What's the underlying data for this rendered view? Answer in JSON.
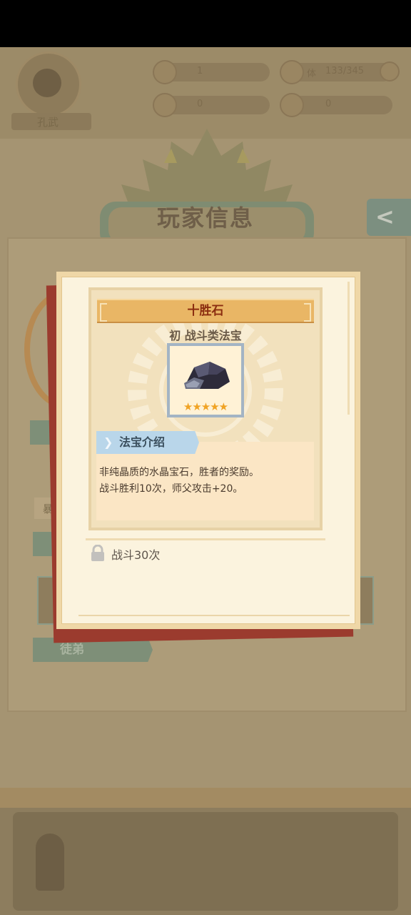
{
  "background": {
    "player_name": "孔武",
    "stat_top_left": "1",
    "stat_top_right_label": "体",
    "stat_top_right_value": "133/345",
    "stat_mid_left": "0",
    "stat_mid_right": "0",
    "title": "玩家信息",
    "side_label": "暴",
    "tab_bottom": "徒弟"
  },
  "modal": {
    "item_name": "十胜石",
    "item_type": "初 战斗类法宝",
    "stars": "★★★★★",
    "intro_title": "法宝介绍",
    "description_lines": [
      "非纯晶质的水晶宝石，胜者的奖励。",
      "战斗胜利10次，师父攻击+20。"
    ],
    "unlock_condition": "战斗30次"
  },
  "colors": {
    "overlay_bg": "#a59472",
    "modal_bg": "#fbf3de",
    "title_bar": "#e9b665",
    "item_name": "#8b2d10",
    "intro_tab": "#b9d6ea",
    "star": "#f0a324"
  },
  "icons": [
    "back-arrow-icon",
    "lock-icon",
    "item-obsidian-stone-icon",
    "avatar-icon",
    "crown-emblem-icon"
  ]
}
